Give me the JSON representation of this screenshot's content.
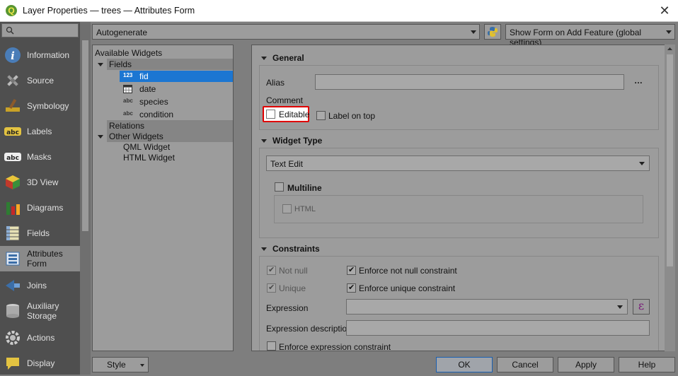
{
  "window": {
    "title": "Layer Properties — trees — Attributes Form",
    "close": "✕"
  },
  "nav": {
    "items": [
      {
        "label": "Information"
      },
      {
        "label": "Source"
      },
      {
        "label": "Symbology"
      },
      {
        "label": "Labels"
      },
      {
        "label": "Masks"
      },
      {
        "label": "3D View"
      },
      {
        "label": "Diagrams"
      },
      {
        "label": "Fields"
      },
      {
        "label1": "Attributes",
        "label2": "Form"
      },
      {
        "label": "Joins"
      },
      {
        "label1": "Auxiliary",
        "label2": "Storage"
      },
      {
        "label": "Actions"
      },
      {
        "label": "Display"
      }
    ]
  },
  "toolbar": {
    "layout_combo": "Autogenerate",
    "show_form_combo": "Show Form on Add Feature (global settings)"
  },
  "tree": {
    "header": "Available Widgets",
    "fields_label": "Fields",
    "fields": [
      {
        "icon": "123",
        "name": "fid"
      },
      {
        "icon": "cal",
        "name": "date"
      },
      {
        "icon": "abc",
        "name": "species"
      },
      {
        "icon": "abc",
        "name": "condition"
      }
    ],
    "relations_label": "Relations",
    "other_label": "Other Widgets",
    "other": [
      "QML Widget",
      "HTML Widget"
    ]
  },
  "general": {
    "title": "General",
    "alias_label": "Alias",
    "alias_value": "",
    "more": "…",
    "comment_label": "Comment",
    "editable_label": "Editable",
    "label_on_top": "Label on top"
  },
  "widget_type": {
    "title": "Widget Type",
    "combo": "Text Edit",
    "multiline": "Multiline",
    "html": "HTML"
  },
  "constraints": {
    "title": "Constraints",
    "not_null": "Not null",
    "enforce_not_null": "Enforce not null constraint",
    "unique": "Unique",
    "enforce_unique": "Enforce unique constraint",
    "expression_label": "Expression",
    "expression_desc_label": "Expression description",
    "enforce_expression": "Enforce expression constraint",
    "epsilon": "ε"
  },
  "footer": {
    "style": "Style",
    "ok": "OK",
    "cancel": "Cancel",
    "apply": "Apply",
    "help": "Help"
  }
}
